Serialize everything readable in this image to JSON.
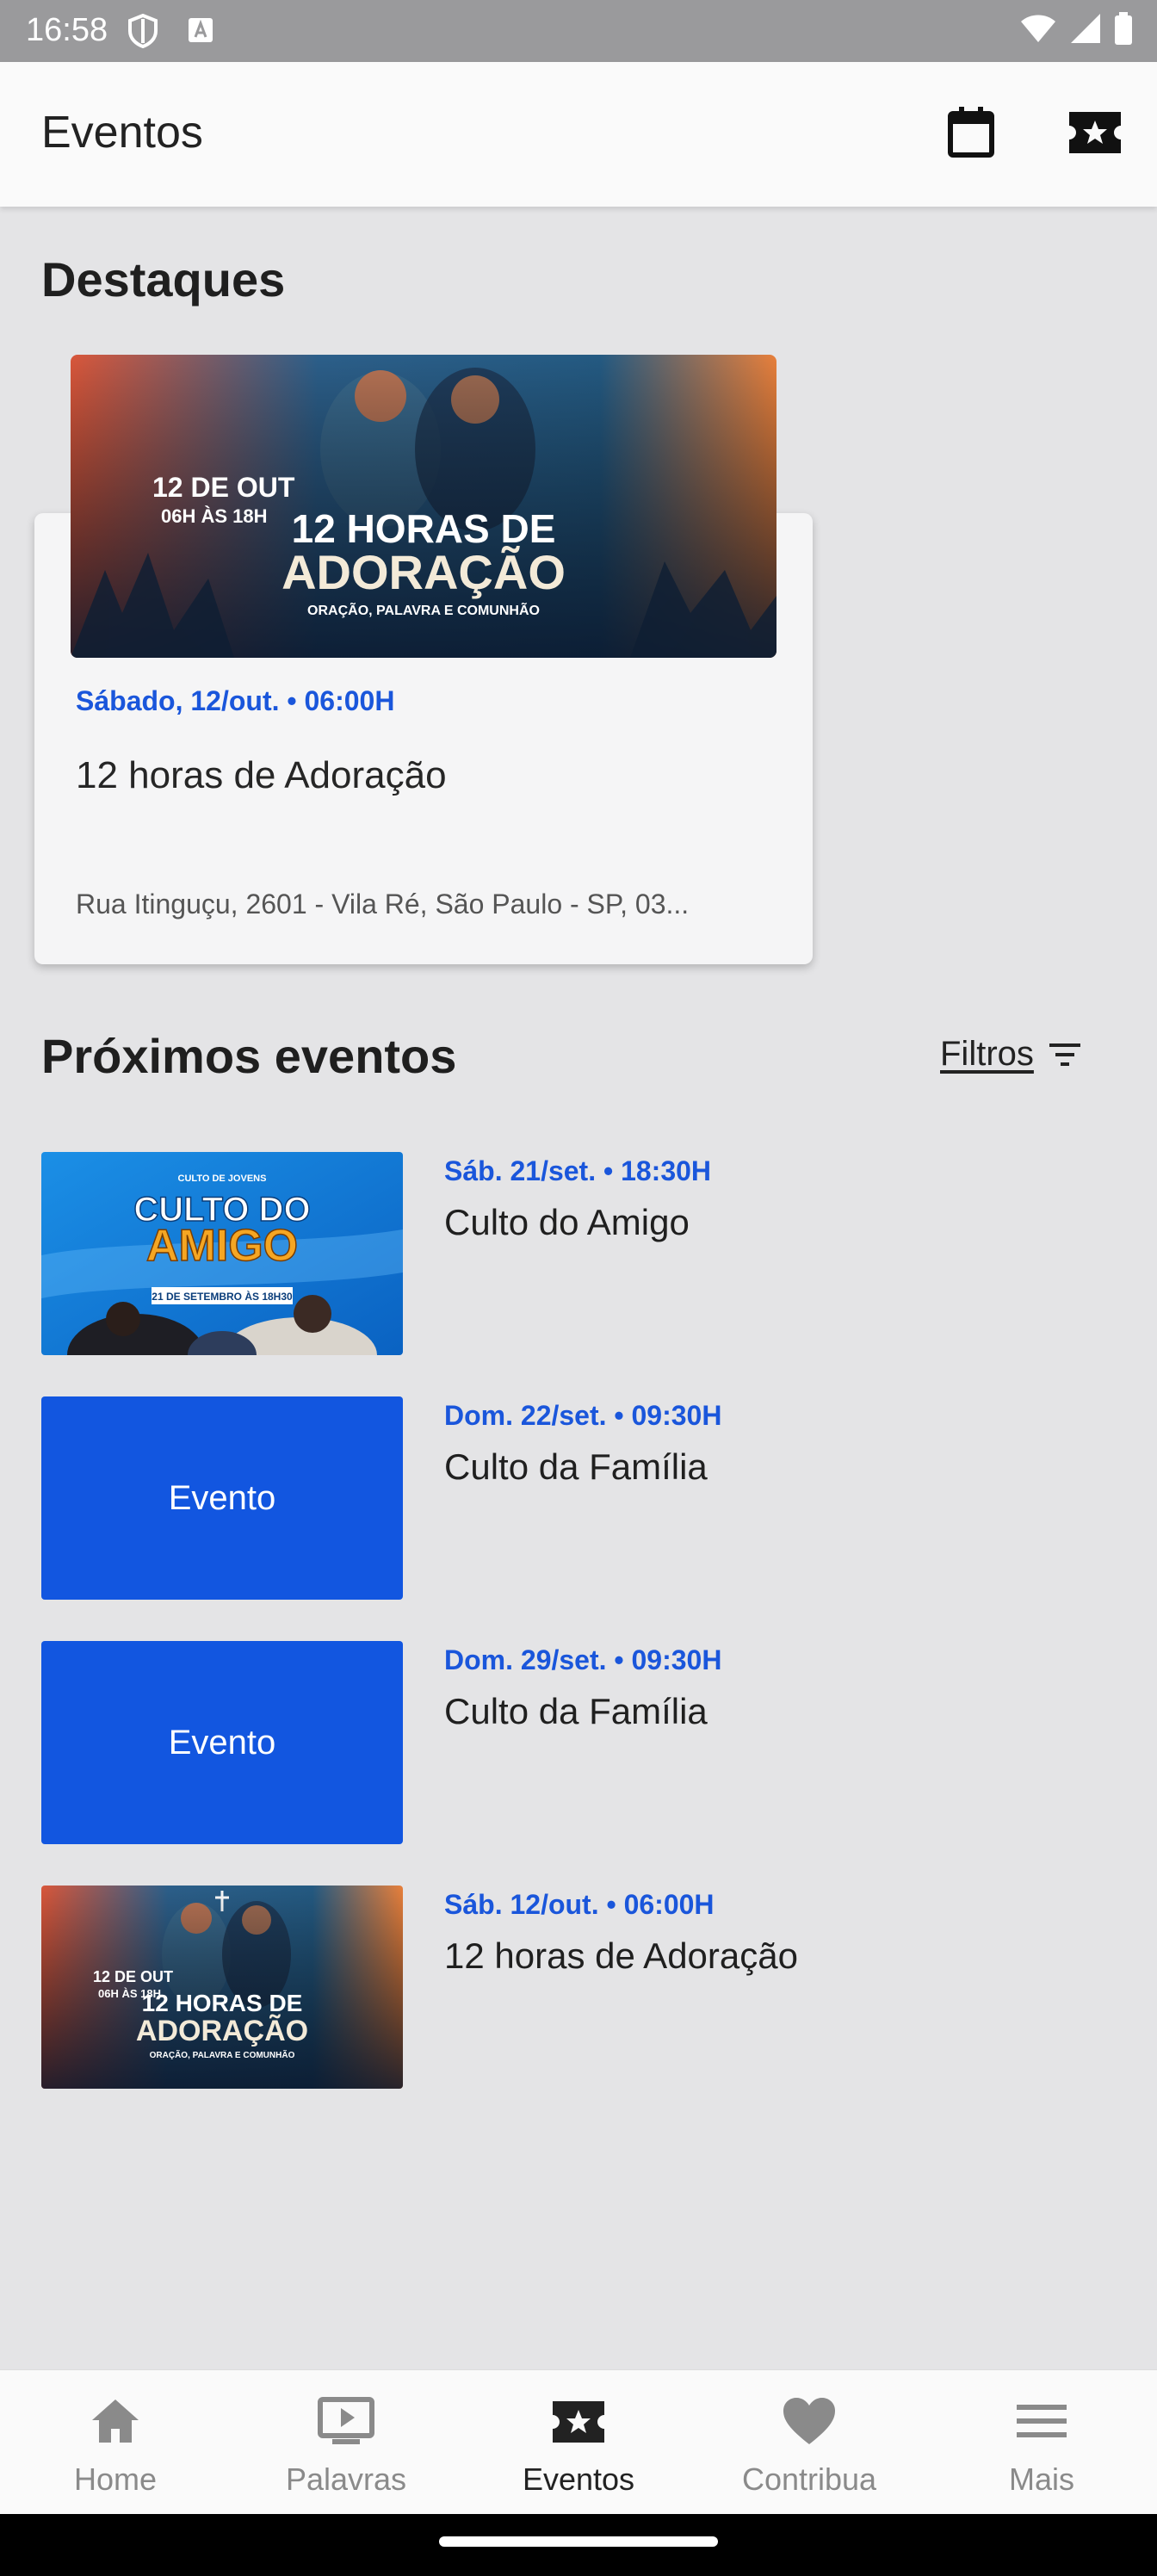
{
  "status_bar": {
    "time": "16:58"
  },
  "app_bar": {
    "title": "Eventos"
  },
  "highlights": {
    "title": "Destaques",
    "card": {
      "image_text": {
        "date": "12 DE OUT",
        "time": "06H ÀS 18H",
        "headline1": "12 HORAS DE",
        "headline2": "ADORAÇÃO",
        "subtitle": "ORAÇÃO, PALAVRA E COMUNHÃO"
      },
      "date": "Sábado, 12/out. • 06:00H",
      "title": "12 horas de Adoração",
      "address": "Rua Itinguçu, 2601 - Vila Ré, São Paulo - SP, 03..."
    }
  },
  "upcoming": {
    "title": "Próximos eventos",
    "filters_label": "Filtros",
    "events": [
      {
        "date": "Sáb. 21/set. • 18:30H",
        "name": "Culto do Amigo",
        "thumb": "culto-amigo",
        "thumb_text": {
          "top": "CULTO DE JOVENS",
          "l1": "CULTO DO",
          "l2": "AMIGO",
          "band": "21 DE SETEMBRO ÀS 18H30"
        }
      },
      {
        "date": "Dom. 22/set. • 09:30H",
        "name": "Culto da Família",
        "thumb": "placeholder",
        "placeholder_label": "Evento"
      },
      {
        "date": "Dom. 29/set. • 09:30H",
        "name": "Culto da Família",
        "thumb": "placeholder",
        "placeholder_label": "Evento"
      },
      {
        "date": "Sáb. 12/out. • 06:00H",
        "name": "12 horas de Adoração",
        "thumb": "adoracao",
        "thumb_text": {
          "date": "12 DE OUT",
          "time": "06H ÀS 18H",
          "l1": "12 HORAS DE",
          "l2": "ADORAÇÃO",
          "sub": "ORAÇÃO, PALAVRA E COMUNHÃO"
        }
      }
    ]
  },
  "bottom_nav": [
    {
      "label": "Home",
      "icon": "home-icon",
      "active": false
    },
    {
      "label": "Palavras",
      "icon": "play-screen-icon",
      "active": false
    },
    {
      "label": "Eventos",
      "icon": "ticket-star-icon",
      "active": true
    },
    {
      "label": "Contribua",
      "icon": "heart-icon",
      "active": false
    },
    {
      "label": "Mais",
      "icon": "menu-icon",
      "active": false
    }
  ],
  "colors": {
    "accent_blue": "#1a56db",
    "placeholder_blue": "#1256e0",
    "background": "#e4e4e6"
  }
}
